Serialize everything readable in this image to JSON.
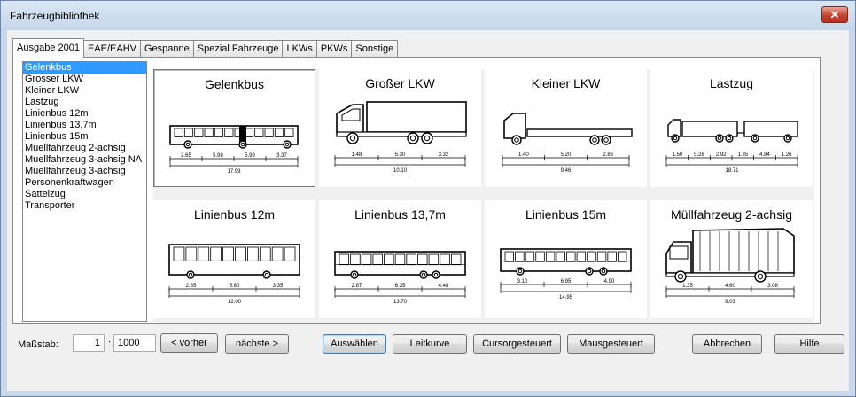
{
  "window": {
    "title": "Fahrzeugbibliothek",
    "close_label": "✕"
  },
  "tabs": [
    {
      "label": "Ausgabe 2001"
    },
    {
      "label": "EAE/EAHV"
    },
    {
      "label": "Gespanne"
    },
    {
      "label": "Spezial Fahrzeuge"
    },
    {
      "label": "LKWs"
    },
    {
      "label": "PKWs"
    },
    {
      "label": "Sonstige"
    }
  ],
  "vehicle_list": [
    {
      "label": "Gelenkbus"
    },
    {
      "label": "Grosser LKW"
    },
    {
      "label": "Kleiner LKW"
    },
    {
      "label": "Lastzug"
    },
    {
      "label": "Linienbus 12m"
    },
    {
      "label": "Linienbus 13,7m"
    },
    {
      "label": "Linienbus 15m"
    },
    {
      "label": "Muellfahrzeug 2-achsig"
    },
    {
      "label": "Muellfahrzeug 3-achsig NA"
    },
    {
      "label": "Muellfahrzeug 3-achsig"
    },
    {
      "label": "Personenkraftwagen"
    },
    {
      "label": "Sattelzug"
    },
    {
      "label": "Transporter"
    }
  ],
  "cards": [
    {
      "title": "Gelenkbus",
      "kind": "artic-bus",
      "dims": [
        "2.65",
        "5.98",
        "5.99",
        "3.37"
      ],
      "total": "17.99"
    },
    {
      "title": "Großer LKW",
      "kind": "big-truck",
      "dims": [
        "1.48",
        "5.30",
        "3.32"
      ],
      "total": "10.10"
    },
    {
      "title": "Kleiner LKW",
      "kind": "small-truck",
      "dims": [
        "1.40",
        "5.20",
        "2.86"
      ],
      "total": "9.46"
    },
    {
      "title": "Lastzug",
      "kind": "road-train",
      "dims": [
        "1.50",
        "5.28",
        "2.92",
        "1.35",
        "4.84",
        "1.26"
      ],
      "total": "18.71"
    },
    {
      "title": "Linienbus 12m",
      "kind": "bus12",
      "dims": [
        "2.85",
        "5.80",
        "3.35"
      ],
      "total": "12.00"
    },
    {
      "title": "Linienbus 13,7m",
      "kind": "bus137",
      "dims": [
        "2.87",
        "6.35",
        "4.48"
      ],
      "total": "13.70"
    },
    {
      "title": "Linienbus 15m",
      "kind": "bus15",
      "dims": [
        "3.10",
        "6.95",
        "4.90"
      ],
      "total": "14.95"
    },
    {
      "title": "Müllfahrzeug 2-achsig",
      "kind": "garbage",
      "dims": [
        "1.35",
        "4.60",
        "3.08"
      ],
      "total": "9.03"
    }
  ],
  "scale": {
    "label": "Maßstab:",
    "left": "1",
    "separator": ":",
    "right": "1000"
  },
  "buttons": {
    "prev": "< vorher",
    "next": "nächste >",
    "select": "Auswählen",
    "leitkurve": "Leitkurve",
    "cursor": "Cursorgesteuert",
    "mouse": "Mausgesteuert",
    "cancel": "Abbrechen",
    "help": "Hilfe"
  }
}
